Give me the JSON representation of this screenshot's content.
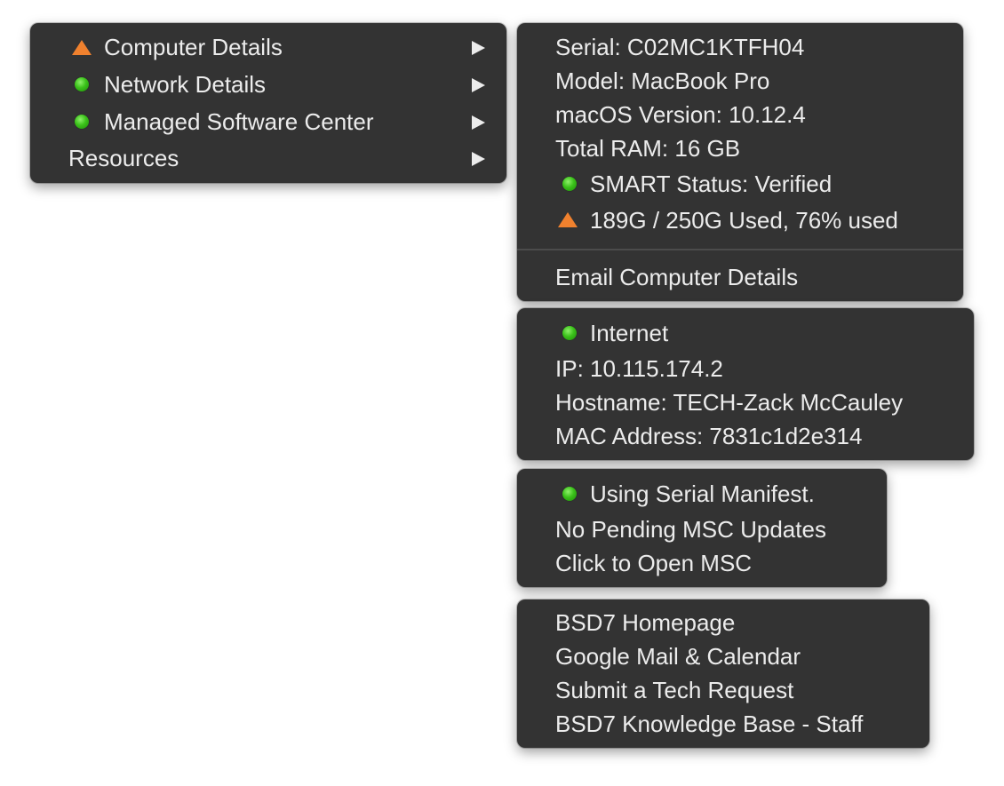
{
  "main_menu": {
    "items": [
      {
        "label": "Computer Details",
        "status": "warning"
      },
      {
        "label": "Network Details",
        "status": "ok"
      },
      {
        "label": "Managed Software Center",
        "status": "ok"
      },
      {
        "label": "Resources",
        "status": "none"
      }
    ]
  },
  "computer_details": {
    "serial": "Serial:  C02MC1KTFH04",
    "model": "Model:  MacBook Pro",
    "os_version": "macOS Version: 10.12.4",
    "ram": "Total RAM:  16 GB",
    "smart_status": "SMART Status: Verified",
    "disk_usage": "189G / 250G Used, 76% used",
    "email_action": "Email Computer Details"
  },
  "network_details": {
    "internet": "Internet",
    "ip": "IP: 10.115.174.2",
    "hostname": "Hostname: TECH-Zack McCauley",
    "mac": "MAC Address: 7831c1d2e314"
  },
  "msc": {
    "manifest": "Using Serial Manifest.",
    "updates": "No Pending MSC Updates",
    "open": "Click to Open MSC"
  },
  "resources": {
    "items": [
      "BSD7 Homepage",
      "Google Mail & Calendar",
      "Submit a Tech Request",
      "BSD7 Knowledge Base - Staff"
    ]
  },
  "colors": {
    "menu_bg": "#333333",
    "text": "#ececec",
    "ok_dot": "#3bc21a",
    "warning_triangle": "#f0812e"
  }
}
